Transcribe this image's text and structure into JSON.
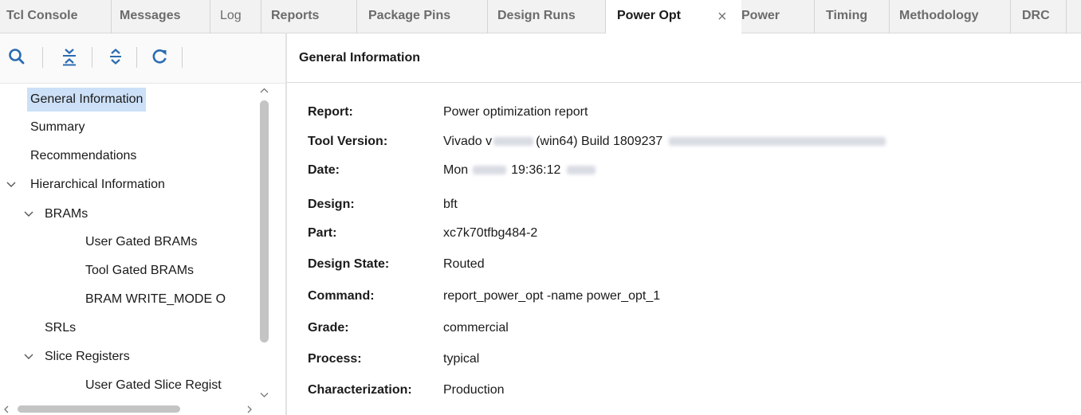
{
  "tabs": [
    {
      "label": "Tcl Console"
    },
    {
      "label": "Messages"
    },
    {
      "label": "Log"
    },
    {
      "label": "Reports"
    },
    {
      "label": "Package Pins"
    },
    {
      "label": "Design Runs"
    },
    {
      "label": "Power Opt"
    },
    {
      "label": "Power"
    },
    {
      "label": "Timing"
    },
    {
      "label": "Methodology"
    },
    {
      "label": "DRC"
    }
  ],
  "active_tab": "Power Opt",
  "toolbar": {
    "icons": [
      "search-icon",
      "collapse-all-icon",
      "expand-all-icon",
      "refresh-icon"
    ]
  },
  "tree": {
    "items": [
      {
        "label": "General Information",
        "selected": true
      },
      {
        "label": "Summary"
      },
      {
        "label": "Recommendations"
      },
      {
        "label": "Hierarchical Information",
        "expanded": true
      },
      {
        "label": "BRAMs",
        "expanded": true
      },
      {
        "label": "User Gated BRAMs"
      },
      {
        "label": "Tool Gated BRAMs"
      },
      {
        "label": "BRAM WRITE_MODE O"
      },
      {
        "label": "SRLs"
      },
      {
        "label": "Slice Registers",
        "expanded": true
      },
      {
        "label": "User Gated Slice Regist"
      }
    ]
  },
  "panel": {
    "title": "General Information"
  },
  "info": {
    "report": {
      "label": "Report:",
      "value": "Power optimization report"
    },
    "tool_version": {
      "label": "Tool Version:",
      "value_a": "Vivado v",
      "value_b": "(win64) Build 1809237"
    },
    "date": {
      "label": "Date:",
      "value_a": "Mon",
      "value_b": "19:36:12"
    },
    "design": {
      "label": "Design:",
      "value": "bft"
    },
    "part": {
      "label": "Part:",
      "value": "xc7k70tfbg484-2"
    },
    "design_state": {
      "label": "Design State:",
      "value": "Routed"
    },
    "command": {
      "label": "Command:",
      "value": "report_power_opt -name power_opt_1"
    },
    "grade": {
      "label": "Grade:",
      "value": "commercial"
    },
    "process": {
      "label": "Process:",
      "value": "typical"
    },
    "characterization": {
      "label": "Characterization:",
      "value": "Production"
    }
  },
  "colors": {
    "selection": "#cce0f7",
    "icon_blue": "#2b6cb0"
  }
}
